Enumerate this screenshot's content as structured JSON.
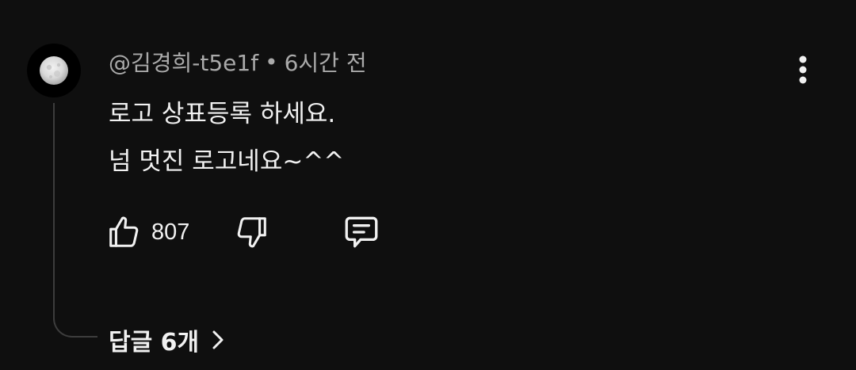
{
  "comment": {
    "author": "@김경희-t5e1f",
    "separator": "•",
    "time_ago": "6시간 전",
    "lines": [
      "로고 상표등록 하세요.",
      "넘 멋진 로고네요~^^"
    ],
    "like_count": "807",
    "replies_label": "답글 6개"
  },
  "icons": {
    "avatar": "moon-avatar",
    "more": "vertical-dots-icon",
    "like": "thumbs-up-icon",
    "dislike": "thumbs-down-icon",
    "reply": "comment-bubble-icon",
    "expand": "chevron-right-icon"
  },
  "colors": {
    "background": "#0f0f0f",
    "primary_text": "#f1f1f1",
    "secondary_text": "#aaaaaa",
    "thread_line": "#3d3d3d"
  }
}
